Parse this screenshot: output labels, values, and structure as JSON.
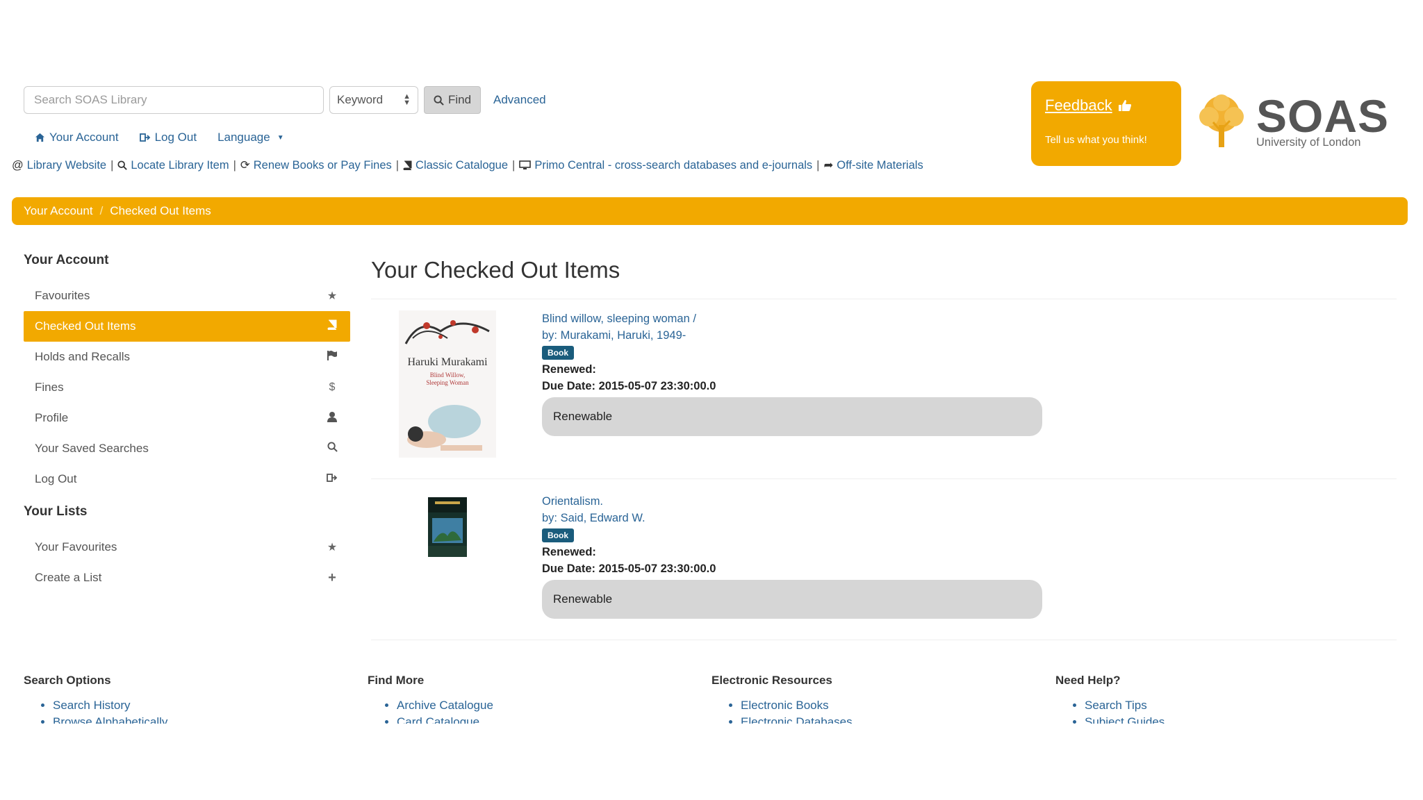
{
  "search": {
    "placeholder": "Search SOAS Library",
    "type_value": "Keyword",
    "find_label": "Find",
    "advanced_label": "Advanced"
  },
  "util_nav": {
    "account": "Your Account",
    "logout": "Log Out",
    "language": "Language"
  },
  "links_bar": [
    "Library Website",
    "Locate Library Item",
    "Renew Books or Pay Fines",
    "Classic Catalogue",
    "Primo Central - cross-search databases and e-journals",
    "Off-site Materials"
  ],
  "feedback": {
    "title": "Feedback",
    "subtitle": "Tell us what you think!"
  },
  "logo": {
    "name": "SOAS",
    "subtitle": "University of London"
  },
  "breadcrumb": {
    "items": [
      "Your Account",
      "Checked Out Items"
    ]
  },
  "sidebar": {
    "account_heading": "Your Account",
    "account_items": [
      {
        "label": "Favourites",
        "icon": "star-icon"
      },
      {
        "label": "Checked Out Items",
        "icon": "book-icon",
        "active": true
      },
      {
        "label": "Holds and Recalls",
        "icon": "flag-icon"
      },
      {
        "label": "Fines",
        "icon": "dollar-icon"
      },
      {
        "label": "Profile",
        "icon": "user-icon"
      },
      {
        "label": "Your Saved Searches",
        "icon": "search-icon"
      },
      {
        "label": "Log Out",
        "icon": "sign-out-icon"
      }
    ],
    "lists_heading": "Your Lists",
    "lists_items": [
      {
        "label": "Your Favourites",
        "icon": "star-icon"
      },
      {
        "label": "Create a List",
        "icon": "plus-icon"
      }
    ]
  },
  "main": {
    "title": "Your Checked Out Items",
    "items": [
      {
        "title": "Blind willow, sleeping woman /",
        "author": "by: Murakami, Haruki, 1949-",
        "format": "Book",
        "renewed_label": "Renewed:",
        "due_date": "Due Date: 2015-05-07 23:30:00.0",
        "status": "Renewable",
        "cover_author": "Haruki Murakami",
        "cover_subtitle": "Blind Willow, Sleeping Woman"
      },
      {
        "title": "Orientalism.",
        "author": "by: Said, Edward W.",
        "format": "Book",
        "renewed_label": "Renewed:",
        "due_date": "Due Date: 2015-05-07 23:30:00.0",
        "status": "Renewable"
      }
    ]
  },
  "footer": [
    {
      "heading": "Search Options",
      "links": [
        "Search History",
        "Browse Alphabetically"
      ]
    },
    {
      "heading": "Find More",
      "links": [
        "Archive Catalogue",
        "Card Catalogue"
      ]
    },
    {
      "heading": "Electronic Resources",
      "links": [
        "Electronic Books",
        "Electronic Databases"
      ]
    },
    {
      "heading": "Need Help?",
      "links": [
        "Search Tips",
        "Subject Guides"
      ]
    }
  ],
  "colors": {
    "accent": "#f2a900",
    "link": "#2a6496",
    "badge": "#1a5c7c"
  }
}
